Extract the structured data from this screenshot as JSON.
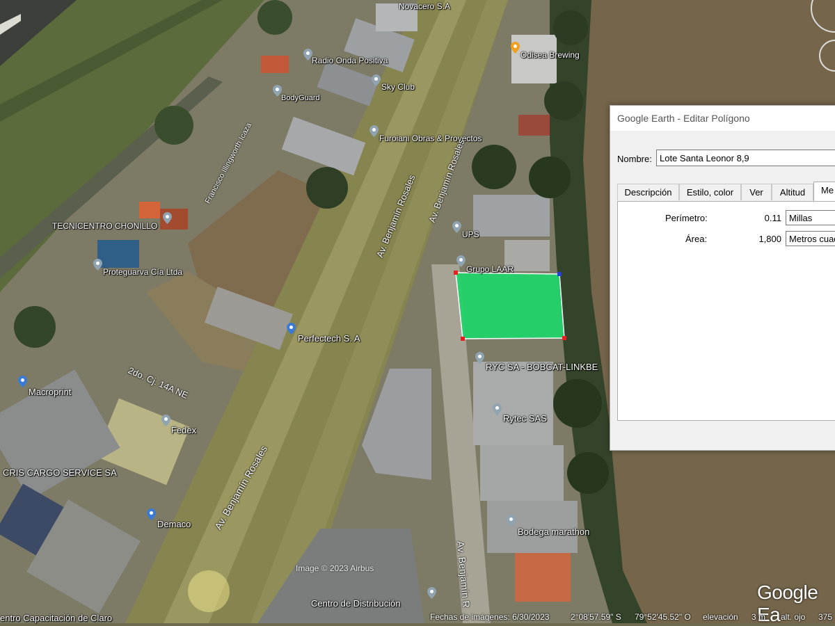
{
  "map": {
    "places": [
      {
        "name": "Novacero S.A"
      },
      {
        "name": "Odisea Brewing"
      },
      {
        "name": "Radio Onda Positiva"
      },
      {
        "name": "Sky Club"
      },
      {
        "name": "BodyGuard"
      },
      {
        "name": "Furoiani Obras & Proyectos"
      },
      {
        "name": "TECNICENTRO CHONILLO"
      },
      {
        "name": "UPS"
      },
      {
        "name": "Grupo LAAR"
      },
      {
        "name": "Proteguarva Cía Ltda"
      },
      {
        "name": "Perfectech S. A"
      },
      {
        "name": "RYC SA - BOBCAT-LINKBE"
      },
      {
        "name": "Macroprint"
      },
      {
        "name": "Rytec SAS"
      },
      {
        "name": "Fedex"
      },
      {
        "name": "CRIS CARGO SERVICE SA"
      },
      {
        "name": "Demaco"
      },
      {
        "name": "Bodega marathon"
      },
      {
        "name": "Centro de Distribución"
      },
      {
        "name": "entro Capacitación de Claro"
      }
    ],
    "roads": [
      {
        "name": "Francisco Illingworth Icaza"
      },
      {
        "name": "Av. Benjamín Rosales"
      },
      {
        "name": "Av. Benjamín Rosales"
      },
      {
        "name": "Av. Benjamín Rosales"
      },
      {
        "name": "Av. Benjamín R"
      },
      {
        "name": "2do. Cj. 14A NE"
      }
    ],
    "copyright": "Image © 2023 Airbus",
    "logo": "Google Ea",
    "colors": {
      "polygon": "#22d36a",
      "pin": "#8fa3b0"
    }
  },
  "status_bar": {
    "imagery_date": "Fechas de imágenes: 6/30/2023",
    "lat": "2°08'57.59\" S",
    "lon": "79°52'45.52\" O",
    "elevation_label": "elevación",
    "elevation_value": "3 m",
    "eye_alt_label": "alt. ojo",
    "eye_alt_value": "375"
  },
  "dialog": {
    "title": "Google Earth - Editar Polígono",
    "name_label": "Nombre:",
    "name_value": "Lote Santa Leonor 8,9",
    "tabs": [
      "Descripción",
      "Estilo, color",
      "Ver",
      "Altitud",
      "Me"
    ],
    "active_tab": 4,
    "perimeter": {
      "label": "Perímetro:",
      "value": "0.11",
      "unit": "Millas"
    },
    "area": {
      "label": "Área:",
      "value": "1,800",
      "unit": "Metros cuad"
    }
  }
}
